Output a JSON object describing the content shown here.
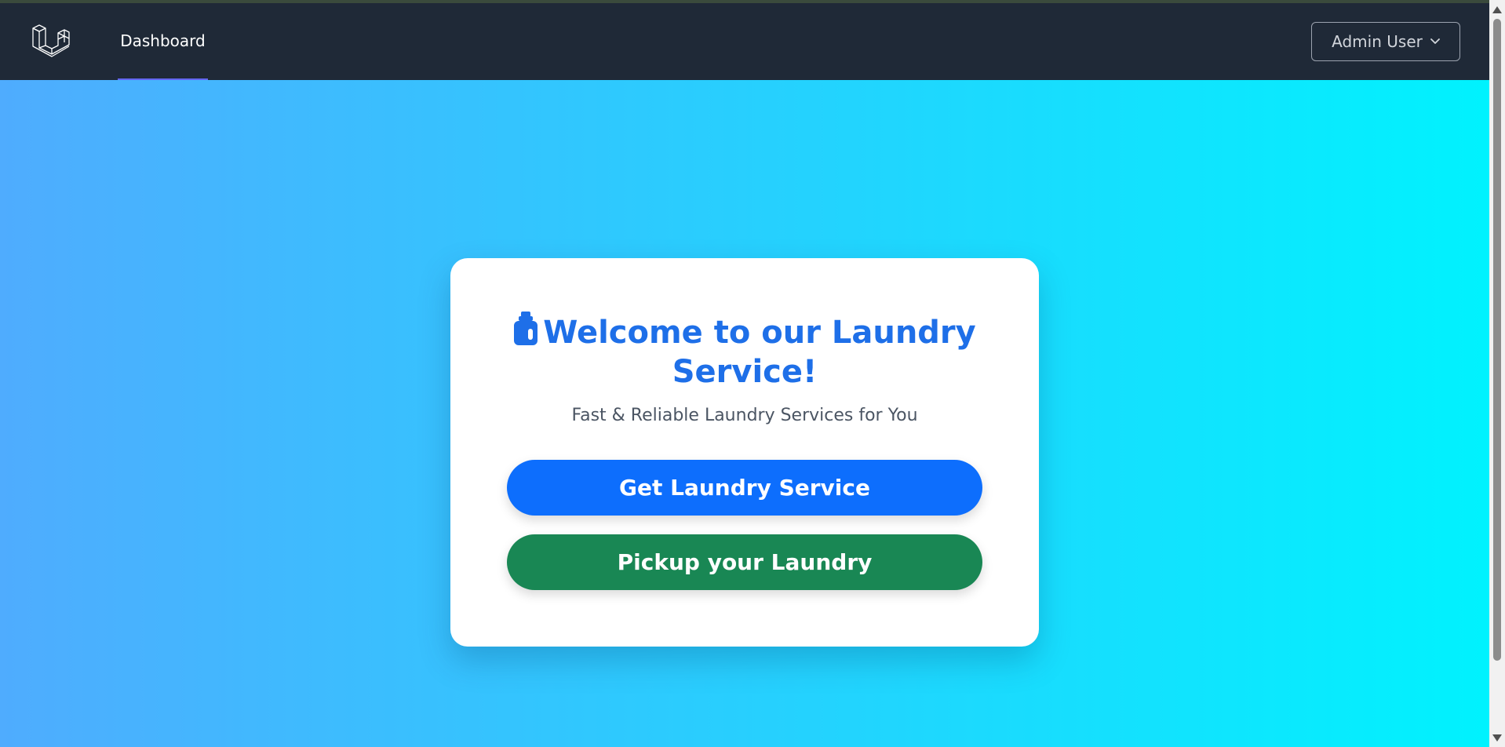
{
  "navbar": {
    "logo_icon": "laravel-logo-icon",
    "links": [
      {
        "label": "Dashboard",
        "active": true
      }
    ],
    "user_menu": {
      "label": "Admin User",
      "icon": "chevron-down-icon"
    }
  },
  "hero": {
    "gradient": [
      "#4facfe",
      "#00f2fe"
    ],
    "card": {
      "icon": "detergent-bottle-icon",
      "title": "Welcome to our Laundry Service!",
      "subtitle": "Fast & Reliable Laundry Services for You",
      "buttons": [
        {
          "label": "Get Laundry Service",
          "color": "#0d6efd"
        },
        {
          "label": "Pickup your Laundry",
          "color": "#198754"
        }
      ]
    }
  },
  "colors": {
    "navbar_bg": "#1f2937",
    "title": "#1e6fe8",
    "active_underline": "#6366f1"
  }
}
